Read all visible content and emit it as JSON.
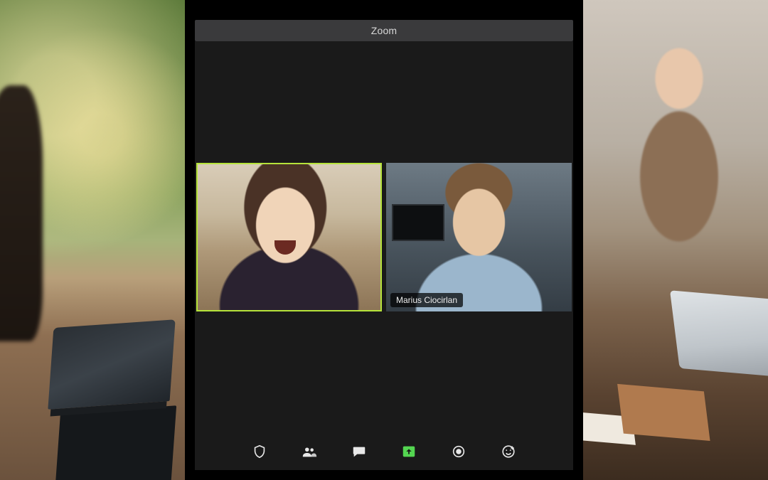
{
  "app": {
    "title": "Zoom"
  },
  "participants": [
    {
      "name": "",
      "active_speaker": true
    },
    {
      "name": "Marius Ciocirlan",
      "active_speaker": false
    }
  ],
  "toolbar": {
    "security_label": "Security",
    "participants_label": "Participants",
    "chat_label": "Chat",
    "share_label": "Share Screen",
    "record_label": "Record",
    "reactions_label": "Reactions"
  },
  "icons": {
    "security": "shield-icon",
    "participants": "participants-icon",
    "chat": "chat-icon",
    "share": "share-screen-icon",
    "record": "record-icon",
    "reactions": "reactions-icon"
  }
}
